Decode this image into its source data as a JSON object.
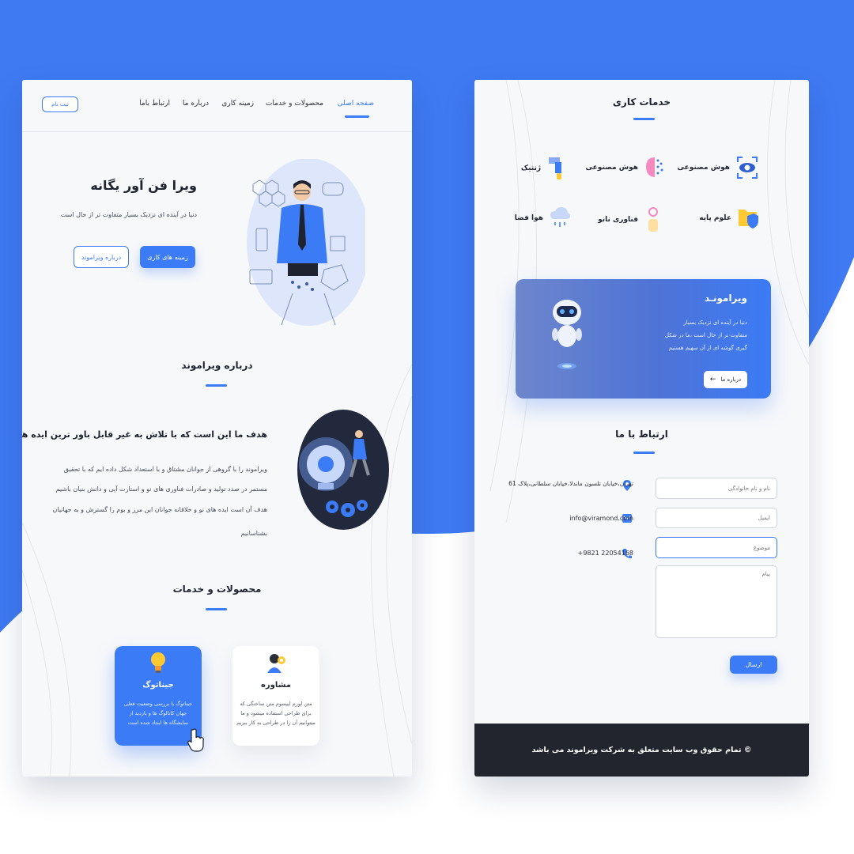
{
  "colors": {
    "accent": "#3b7bf5",
    "footer_bg": "#23252e",
    "card_bg": "#f7f8fa"
  },
  "nav": {
    "items": [
      "صفحه اصلی",
      "محصولات و خدمات",
      "زمینه کاری",
      "درباره ما",
      "ارتباط باما"
    ],
    "register_label": "ثبت نام"
  },
  "hero": {
    "title": "ویرا فن آور یگانه",
    "subtitle": "دنیا در آینده ای نزدیک بسیار متفاوت تر از حال است",
    "primary_button": "زمینه های کاری",
    "secondary_button": "درباره ویراموند"
  },
  "about": {
    "heading": "درباره ویراموند",
    "title": "هدف ما این است که با تلاش به غیر قابل باور ترین ایده ها جان دهیم",
    "lines": [
      "ویراموند را با گروهی از جوانان مشتاق و با استعداد شکل داده ایم که با تحقیق",
      "مستمر در صدد تولید و صادرات فناوری های نو و استارت آپی و دانش بنیان باشیم",
      "هدف آن است ایده های نو و خلاقانه جوانان این مرز و بوم را گسترش و به جهانیان",
      "بشناسانیم"
    ]
  },
  "products": {
    "heading": "محصولات و خدمات",
    "cards": [
      {
        "icon": "lightbulb-icon",
        "title": "جیناتوگ",
        "lines": [
          "جیناتوگ با بررسی وضعیت فعلی",
          "جهان کاتالوگ ها و بازدید از",
          "نمایشگاه ها ایجاد شده است"
        ]
      },
      {
        "icon": "consultant-icon",
        "title": "مشاوره",
        "lines": [
          "متن لورم ایپسوم متن ساختگی که",
          "برای طراحی استفاده میشود و ما",
          "میتوانیم آن را در طراحی به کار ببریم"
        ]
      }
    ]
  },
  "services": {
    "heading": "خدمات کاری",
    "items": [
      {
        "label": "هوش مصنوعی",
        "icon": "eye-scan-icon"
      },
      {
        "label": "هوش مصنوعی",
        "icon": "brain-icon"
      },
      {
        "label": "ژنتیک",
        "icon": "dna-pipe-icon"
      },
      {
        "label": "علوم پایه",
        "icon": "folder-shield-icon"
      },
      {
        "label": "فناوری نانو",
        "icon": "nano-hand-icon"
      },
      {
        "label": "هوا فضا",
        "icon": "cloud-icon"
      }
    ]
  },
  "banner": {
    "title": "ویرامونـد",
    "lines": [
      "دنیا در آینده ای نزدیک بسیار",
      "متفاوت تر از حال است ،ما در شکل",
      "گیری گوشه ای از آن سهیم هستیم"
    ],
    "button": "درباره ما"
  },
  "contact": {
    "heading": "ارتباط با ما",
    "address": "تهران،خیابان تلسون ماندلا،خیابان سلطانی،پلاک 61",
    "email": "info@viramond.com",
    "phone": "+9821 22054168",
    "placeholders": {
      "name": "نام و نام خانوادگی",
      "email": "ایمیل",
      "subject": "موضوع",
      "message": "پیام"
    },
    "send": "ارسال"
  },
  "footer": {
    "text": "© تمام حقوق وب سایت متعلق به شرکت ویراموند می باشد"
  }
}
